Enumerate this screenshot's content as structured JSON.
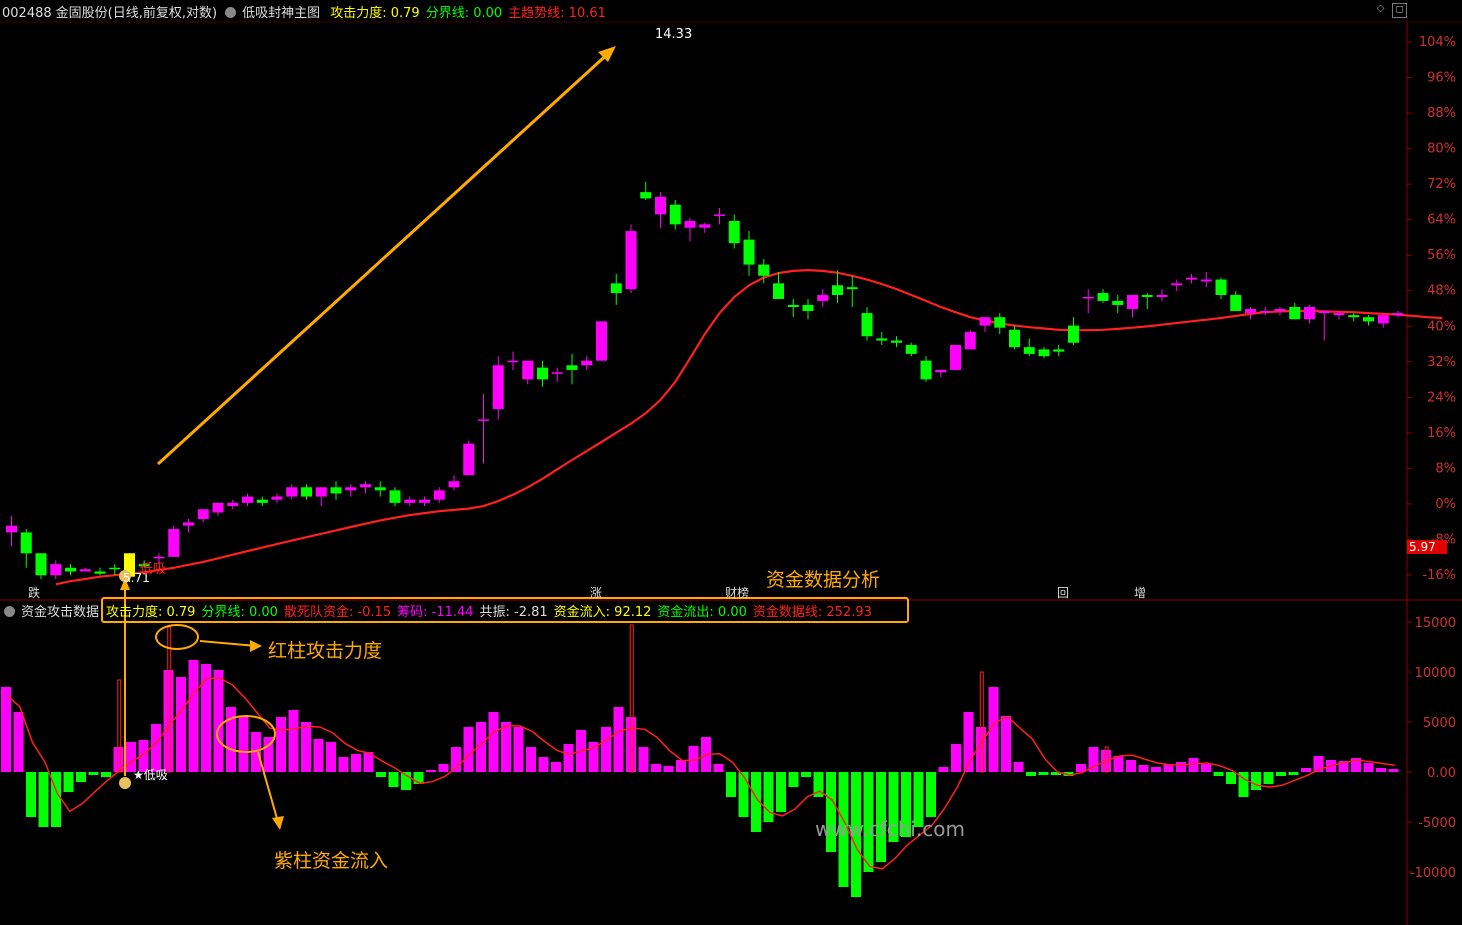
{
  "header_main": {
    "code": "002488",
    "name": "金固股份",
    "mode": "(日线,前复权,对数)",
    "indicator": "低吸封神主图",
    "items": [
      {
        "label": "攻击力度:",
        "value": "0.79",
        "color": "#ffff00"
      },
      {
        "label": "分界线:",
        "value": "0.00",
        "color": "#00ff00"
      },
      {
        "label": "主趋势线:",
        "value": "10.61",
        "color": "#ff2020"
      }
    ]
  },
  "header_sub": {
    "indicator": "资金攻击数据",
    "items": [
      {
        "label": "攻击力度:",
        "value": "0.79",
        "color": "#ffff00"
      },
      {
        "label": "分界线:",
        "value": "0.00",
        "color": "#00ff00"
      },
      {
        "label": "散死队资金:",
        "value": "-0.15",
        "color": "#ff2020"
      },
      {
        "label": "筹码:",
        "value": "-11.44",
        "color": "#ff00ff"
      },
      {
        "label": "共振:",
        "value": "-2.81",
        "color": "#dddddd"
      },
      {
        "label": "资金流入:",
        "value": "92.12",
        "color": "#ffff00"
      },
      {
        "label": "资金流出:",
        "value": "0.00",
        "color": "#00ff00"
      },
      {
        "label": "资金数据线:",
        "value": "252.93",
        "color": "#ff2020"
      }
    ]
  },
  "annotations": {
    "fund_analysis": "资金数据分析",
    "red_bar": "红柱攻击力度",
    "purple_bar": "紫柱资金流入",
    "low_buy": "低吸",
    "low_buy_sub": "★低吸",
    "low_price": "5.71",
    "high_price": "14.33",
    "current_price": "5.97",
    "watermark": "www.cfchi.com",
    "markers": [
      "跌",
      "涨",
      "财榜",
      "回",
      "增"
    ]
  },
  "colors": {
    "up": "#ff00ff",
    "down": "#00ff00",
    "ma": "#ff2020",
    "annot": "#ffaa00",
    "grid": "#8b0000"
  },
  "chart_data": [
    {
      "type": "candlestick",
      "title": "低吸封神主图",
      "y_axis_labels": [
        "104%",
        "96%",
        "88%",
        "80%",
        "72%",
        "64%",
        "56%",
        "48%",
        "40%",
        "32%",
        "24%",
        "16%",
        "8%",
        "0%",
        "-8%",
        "-16%"
      ],
      "candles": [
        [
          6.4,
          6.65,
          6.2,
          6.5
        ],
        [
          6.4,
          6.45,
          5.9,
          6.1
        ],
        [
          6.1,
          6.1,
          5.75,
          5.8
        ],
        [
          5.8,
          6.0,
          5.75,
          5.95
        ],
        [
          5.9,
          5.95,
          5.8,
          5.85
        ],
        [
          5.85,
          5.9,
          5.85,
          5.88
        ],
        [
          5.85,
          5.9,
          5.8,
          5.82
        ],
        [
          5.9,
          5.95,
          5.8,
          5.88
        ],
        [
          5.78,
          6.1,
          5.71,
          6.1
        ],
        [
          5.95,
          6.0,
          5.9,
          5.92
        ],
        [
          6.05,
          6.1,
          5.95,
          6.05
        ],
        [
          6.05,
          6.5,
          6.05,
          6.45
        ],
        [
          6.5,
          6.6,
          6.4,
          6.55
        ],
        [
          6.6,
          6.75,
          6.55,
          6.75
        ],
        [
          6.7,
          6.85,
          6.65,
          6.85
        ],
        [
          6.8,
          6.9,
          6.75,
          6.85
        ],
        [
          6.85,
          7.0,
          6.8,
          6.95
        ],
        [
          6.9,
          6.95,
          6.8,
          6.85
        ],
        [
          6.9,
          7.0,
          6.85,
          6.95
        ],
        [
          6.95,
          7.15,
          6.9,
          7.1
        ],
        [
          7.1,
          7.15,
          6.9,
          6.95
        ],
        [
          6.95,
          7.1,
          6.8,
          7.1
        ],
        [
          7.1,
          7.2,
          6.9,
          7.0
        ],
        [
          7.05,
          7.15,
          6.95,
          7.1
        ],
        [
          7.1,
          7.2,
          7.0,
          7.15
        ],
        [
          7.1,
          7.2,
          6.95,
          7.05
        ],
        [
          7.05,
          7.1,
          6.8,
          6.85
        ],
        [
          6.85,
          6.95,
          6.8,
          6.9
        ],
        [
          6.85,
          6.95,
          6.8,
          6.9
        ],
        [
          6.9,
          7.1,
          6.85,
          7.05
        ],
        [
          7.1,
          7.3,
          7.05,
          7.2
        ],
        [
          7.3,
          7.9,
          7.3,
          7.85
        ],
        [
          8.3,
          8.8,
          7.5,
          8.3
        ],
        [
          8.5,
          9.6,
          8.3,
          9.4
        ],
        [
          9.5,
          9.7,
          9.3,
          9.5
        ],
        [
          9.1,
          9.5,
          9.0,
          9.5
        ],
        [
          9.35,
          9.5,
          8.95,
          9.1
        ],
        [
          9.25,
          9.35,
          9.05,
          9.25
        ],
        [
          9.4,
          9.65,
          9.0,
          9.3
        ],
        [
          9.4,
          9.6,
          9.3,
          9.5
        ],
        [
          9.5,
          10.4,
          9.5,
          10.4
        ],
        [
          11.35,
          11.6,
          10.8,
          11.1
        ],
        [
          11.2,
          13.0,
          11.1,
          12.8
        ],
        [
          14.0,
          14.33,
          13.75,
          13.8
        ],
        [
          13.3,
          14.0,
          12.9,
          13.85
        ],
        [
          13.6,
          13.75,
          12.85,
          13.0
        ],
        [
          12.9,
          13.2,
          12.5,
          13.1
        ],
        [
          12.9,
          13.05,
          12.75,
          13.0
        ],
        [
          13.3,
          13.5,
          13.0,
          13.3
        ],
        [
          13.1,
          13.3,
          12.3,
          12.45
        ],
        [
          12.55,
          12.8,
          11.55,
          11.85
        ],
        [
          11.85,
          12.0,
          11.35,
          11.55
        ],
        [
          11.35,
          11.65,
          10.95,
          10.95
        ],
        [
          10.8,
          10.95,
          10.5,
          10.75
        ],
        [
          10.8,
          10.95,
          10.45,
          10.65
        ],
        [
          10.9,
          11.2,
          10.75,
          11.05
        ],
        [
          11.3,
          11.7,
          10.85,
          11.05
        ],
        [
          11.25,
          11.55,
          10.75,
          11.2
        ],
        [
          10.6,
          10.75,
          9.95,
          10.05
        ],
        [
          10.0,
          10.15,
          9.85,
          9.95
        ],
        [
          9.95,
          10.05,
          9.8,
          9.9
        ],
        [
          9.85,
          9.9,
          9.6,
          9.65
        ],
        [
          9.5,
          9.6,
          9.05,
          9.1
        ],
        [
          9.25,
          9.3,
          9.15,
          9.3
        ],
        [
          9.3,
          9.85,
          9.3,
          9.85
        ],
        [
          9.75,
          10.2,
          9.75,
          10.15
        ],
        [
          10.3,
          10.5,
          10.15,
          10.5
        ],
        [
          10.5,
          10.6,
          10.1,
          10.25
        ],
        [
          10.2,
          10.3,
          9.75,
          9.8
        ],
        [
          9.8,
          10.0,
          9.6,
          9.65
        ],
        [
          9.75,
          9.8,
          9.55,
          9.6
        ],
        [
          9.75,
          9.85,
          9.6,
          9.7
        ],
        [
          10.3,
          10.5,
          9.85,
          9.9
        ],
        [
          11.0,
          11.2,
          10.6,
          11.0
        ],
        [
          11.1,
          11.2,
          10.85,
          10.9
        ],
        [
          10.9,
          11.05,
          10.6,
          10.8
        ],
        [
          10.7,
          11.05,
          10.5,
          11.05
        ],
        [
          11.05,
          11.1,
          10.7,
          11.0
        ],
        [
          11.0,
          11.2,
          10.9,
          11.05
        ],
        [
          11.3,
          11.45,
          11.15,
          11.35
        ],
        [
          11.45,
          11.6,
          11.35,
          11.5
        ],
        [
          11.4,
          11.65,
          11.25,
          11.45
        ],
        [
          11.45,
          11.5,
          10.95,
          11.05
        ],
        [
          11.05,
          11.15,
          10.65,
          10.65
        ],
        [
          10.6,
          10.75,
          10.45,
          10.7
        ],
        [
          10.65,
          10.75,
          10.55,
          10.65
        ],
        [
          10.65,
          10.75,
          10.55,
          10.7
        ],
        [
          10.75,
          10.85,
          10.45,
          10.45
        ],
        [
          10.45,
          10.8,
          10.35,
          10.75
        ],
        [
          10.6,
          10.65,
          9.95,
          10.65
        ],
        [
          10.55,
          10.65,
          10.45,
          10.6
        ],
        [
          10.55,
          10.6,
          10.4,
          10.5
        ],
        [
          10.5,
          10.55,
          10.3,
          10.4
        ],
        [
          10.35,
          10.6,
          10.25,
          10.55
        ],
        [
          10.55,
          10.65,
          10.5,
          10.6
        ]
      ],
      "ma_line": [
        5.68,
        5.72,
        5.75,
        5.78,
        5.8,
        5.82,
        5.84,
        5.87,
        5.9,
        5.94,
        5.98,
        6.03,
        6.08,
        6.13,
        6.18,
        6.23,
        6.28,
        6.33,
        6.38,
        6.43,
        6.48,
        6.53,
        6.58,
        6.62,
        6.66,
        6.69,
        6.72,
        6.74,
        6.76,
        6.8,
        6.88,
        6.98,
        7.1,
        7.24,
        7.4,
        7.56,
        7.72,
        7.88,
        8.05,
        8.22,
        8.42,
        8.68,
        9.05,
        9.55,
        10.1,
        10.6,
        11.0,
        11.3,
        11.5,
        11.62,
        11.68,
        11.7,
        11.68,
        11.63,
        11.55,
        11.45,
        11.33,
        11.2,
        11.05,
        10.9,
        10.75,
        10.62,
        10.5,
        10.42,
        10.35,
        10.3,
        10.26,
        10.23,
        10.2,
        10.19,
        10.19,
        10.2,
        10.22,
        10.25,
        10.28,
        10.32,
        10.36,
        10.4,
        10.44,
        10.48,
        10.53,
        10.58,
        10.62,
        10.64,
        10.65,
        10.65,
        10.64,
        10.63,
        10.62,
        10.6,
        10.58,
        10.56,
        10.53,
        10.5,
        10.48
      ]
    },
    {
      "type": "bar",
      "title": "资金攻击数据",
      "y_axis_labels": [
        "15000",
        "10000",
        "5000",
        "0.00",
        "-5000",
        "-10000"
      ],
      "ylim": [
        -15000,
        15000
      ],
      "values": [
        8500,
        6000,
        -4500,
        -5500,
        -5500,
        -2000,
        -1000,
        -300,
        -500,
        2500,
        3000,
        3200,
        4800,
        10200,
        9500,
        11200,
        10800,
        10200,
        6500,
        5500,
        4000,
        3500,
        5500,
        6200,
        5000,
        3300,
        3000,
        1500,
        1800,
        2000,
        -500,
        -1500,
        -1800,
        -1200,
        200,
        800,
        2500,
        4500,
        5000,
        6000,
        5000,
        4500,
        2500,
        1500,
        1000,
        2800,
        4200,
        3000,
        4500,
        6500,
        5500,
        2500,
        800,
        600,
        1200,
        2600,
        3500,
        800,
        -2500,
        -4500,
        -6000,
        -5000,
        -4000,
        -1500,
        -500,
        -2500,
        -8000,
        -11500,
        -12500,
        -10000,
        -9000,
        -7000,
        -6500,
        -5500,
        -4500,
        500,
        2800,
        6000,
        4500,
        8500,
        5600,
        1000,
        -400,
        -300,
        -300,
        -400,
        800,
        2500,
        2200,
        1600,
        1200,
        700,
        500,
        800,
        1000,
        1400,
        800,
        -400,
        -1200,
        -2500,
        -1800,
        -1200,
        -400,
        -300,
        400,
        1600,
        1200,
        1100,
        1400,
        900,
        400,
        300
      ]
    }
  ]
}
